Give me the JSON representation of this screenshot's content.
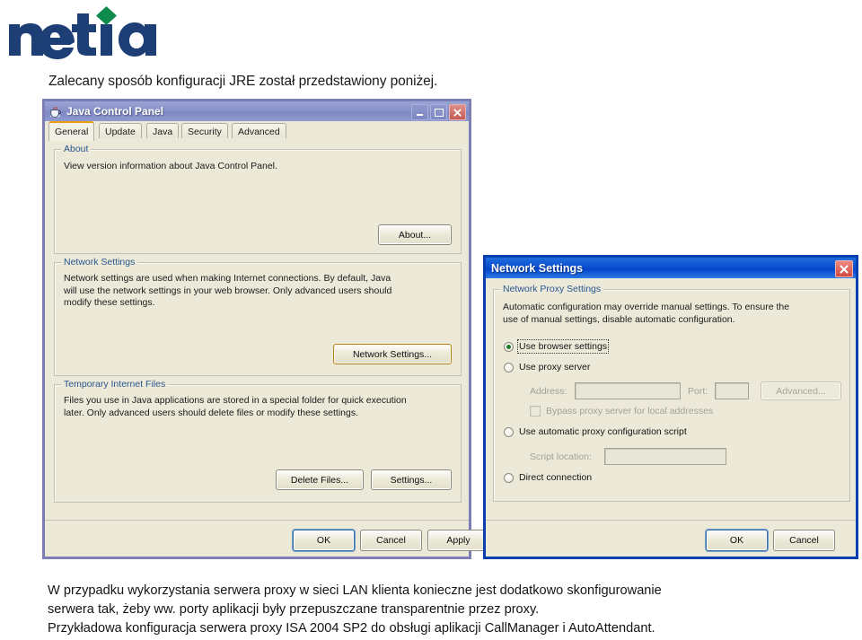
{
  "brand": {
    "name": "netia",
    "wordmark_color": "#1d3f75",
    "diamond_color": "#0f8b4c"
  },
  "intro": {
    "heading": "Zalecany sposób konfiguracji JRE został przedstawiony poniżej."
  },
  "java_control_panel": {
    "title": "Java Control Panel",
    "icon": "java-cup-icon",
    "titlebar_buttons": [
      {
        "name": "minimize",
        "glyph": "_"
      },
      {
        "name": "maximize",
        "glyph": "□"
      },
      {
        "name": "close",
        "glyph": "✕"
      }
    ],
    "tabs": [
      {
        "label": "General",
        "active": true
      },
      {
        "label": "Update",
        "active": false
      },
      {
        "label": "Java",
        "active": false
      },
      {
        "label": "Security",
        "active": false
      },
      {
        "label": "Advanced",
        "active": false
      }
    ],
    "groups": {
      "about": {
        "title": "About",
        "text": "View version information about Java Control Panel.",
        "button": "About..."
      },
      "network_settings": {
        "title": "Network Settings",
        "text_line1": "Network settings are used when making Internet connections.  By default, Java",
        "text_line2": "will use the network settings in your web browser.  Only advanced users should",
        "text_line3": "modify these settings.",
        "button": "Network Settings..."
      },
      "temporary_internet_files": {
        "title": "Temporary Internet Files",
        "text_line1": "Files you use in Java applications are stored in a special folder for quick execution",
        "text_line2": "later.  Only advanced users should delete files or modify these settings.",
        "delete_button": "Delete Files...",
        "settings_button": "Settings..."
      }
    },
    "footer_buttons": {
      "ok": "OK",
      "cancel": "Cancel",
      "apply": "Apply"
    }
  },
  "network_settings_dialog": {
    "title": "Network Settings",
    "close_glyph": "✕",
    "group_title": "Network Proxy Settings",
    "description_line1": "Automatic configuration may override manual settings. To ensure the",
    "description_line2": "use of manual settings, disable automatic configuration.",
    "options": [
      {
        "label": "Use browser settings",
        "selected": true,
        "focused": true
      },
      {
        "label": "Use proxy server",
        "selected": false,
        "focused": false
      },
      {
        "label": "Use automatic proxy configuration script",
        "selected": false,
        "focused": false
      },
      {
        "label": "Direct connection",
        "selected": false,
        "focused": false
      }
    ],
    "proxy_fields": {
      "address_label": "Address:",
      "address_value": "",
      "port_label": "Port:",
      "port_value": "",
      "advanced_button": "Advanced...",
      "bypass_label": "Bypass proxy server for local addresses",
      "bypass_checked": false
    },
    "script_fields": {
      "script_label": "Script location:",
      "script_value": ""
    },
    "footer_buttons": {
      "ok": "OK",
      "cancel": "Cancel"
    }
  },
  "body_text": {
    "line1": "W przypadku wykorzystania serwera proxy w sieci LAN klienta konieczne jest dodatkowo skonfigurowanie",
    "line2": "serwera tak, żeby ww. porty aplikacji były przepuszczane transparentnie przez proxy.",
    "line3": "Przykładowa konfiguracja serwera proxy ISA 2004 SP2 do obsługi aplikacji CallManager i AutoAttendant."
  }
}
